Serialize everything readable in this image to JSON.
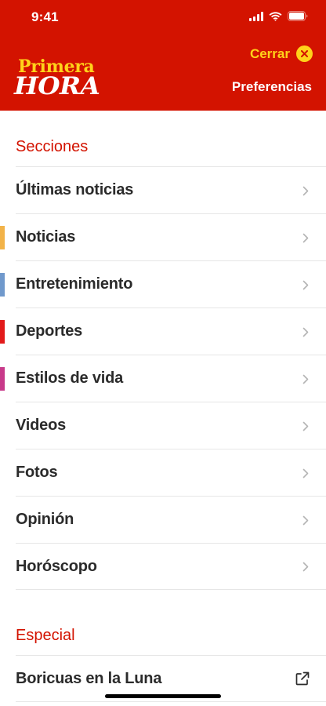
{
  "status_bar": {
    "time": "9:41"
  },
  "header": {
    "logo_top": "Primera",
    "logo_bottom": "HORA",
    "close_label": "Cerrar",
    "preferences_label": "Preferencias",
    "background": "#d31300",
    "accent": "#ffd21a"
  },
  "sections": {
    "title": "Secciones",
    "items": [
      {
        "label": "Últimas noticias",
        "accent": null
      },
      {
        "label": "Noticias",
        "accent": "#f2b349"
      },
      {
        "label": "Entretenimiento",
        "accent": "#7099cc"
      },
      {
        "label": "Deportes",
        "accent": "#e21a1a"
      },
      {
        "label": "Estilos de vida",
        "accent": "#c83a8a"
      },
      {
        "label": "Videos",
        "accent": null
      },
      {
        "label": "Fotos",
        "accent": null
      },
      {
        "label": "Opinión",
        "accent": null
      },
      {
        "label": "Horóscopo",
        "accent": null
      }
    ]
  },
  "special": {
    "title": "Especial",
    "items": [
      {
        "label": "Boricuas en la Luna",
        "icon": "external-link-icon"
      }
    ]
  }
}
